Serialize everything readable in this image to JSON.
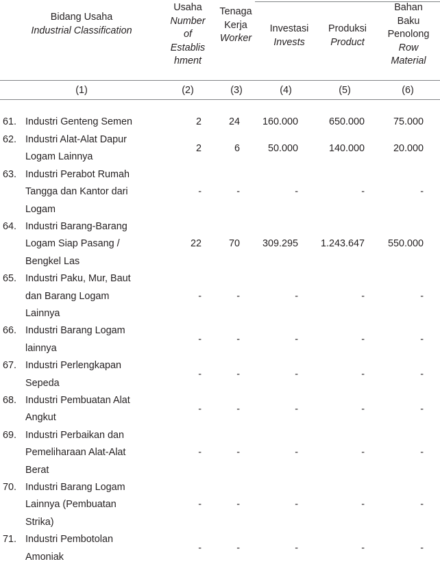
{
  "table": {
    "rules": {
      "color": "#808285"
    },
    "header": {
      "columns": [
        {
          "key": "classification",
          "id": "bidang-usaha",
          "id_label": "Bidang Usaha",
          "en_label": "Industrial Classification"
        },
        {
          "key": "establishment",
          "id": "usaha",
          "id_label": "Usaha",
          "en_label": "Number of Establis hment"
        },
        {
          "key": "worker",
          "id": "tenaga-kerja",
          "id_label": "Tenaga Kerja",
          "en_label": "Worker"
        },
        {
          "key": "invests",
          "id": "investasi",
          "id_label": "Investasi",
          "en_label": "Invests"
        },
        {
          "key": "product",
          "id": "produksi",
          "id_label": "Produksi",
          "en_label": "Product"
        },
        {
          "key": "raw_material",
          "id": "bahan-baku",
          "id_label": "Bahan Baku Penolong",
          "en_label": "Row Material"
        }
      ],
      "col_usaha_lines_id": [
        "Usaha"
      ],
      "col_usaha_lines_en": [
        "Number",
        "of",
        "Establis",
        "hment"
      ],
      "col_tenaga_lines_id": [
        "Tenaga",
        "Kerja"
      ],
      "col_tenaga_lines_en": [
        "Worker"
      ],
      "col_investasi_lines_id": [
        "Investasi"
      ],
      "col_investasi_lines_en": [
        "Invests"
      ],
      "col_produksi_lines_id": [
        "Produksi"
      ],
      "col_produksi_lines_en": [
        "Product"
      ],
      "col_bahan_lines_id": [
        "Bahan",
        "Baku",
        "Penolong"
      ],
      "col_bahan_lines_en": [
        "Row",
        "Material"
      ],
      "col_bidang_lines_id": [
        "Bidang Usaha"
      ],
      "col_bidang_lines_en": [
        "Industrial Classification"
      ]
    },
    "column_numbers": [
      "(1)",
      "(2)",
      "(3)",
      "(4)",
      "(5)",
      "(6)"
    ],
    "rows": [
      {
        "no": "61.",
        "name_lines": [
          "Industri Genteng Semen"
        ],
        "values": [
          "2",
          "24",
          "160.000",
          "650.000",
          "75.000"
        ]
      },
      {
        "no": "62.",
        "name_lines": [
          "Industri Alat-Alat Dapur",
          "Logam Lainnya"
        ],
        "values": [
          "2",
          "6",
          "50.000",
          "140.000",
          "20.000"
        ]
      },
      {
        "no": "63.",
        "name_lines": [
          "Industri Perabot Rumah",
          "Tangga dan Kantor dari",
          "Logam"
        ],
        "values": [
          "-",
          "-",
          "-",
          "-",
          "-"
        ]
      },
      {
        "no": "64.",
        "name_lines": [
          "Industri Barang-Barang",
          "Logam Siap Pasang /",
          "Bengkel Las"
        ],
        "values": [
          "22",
          "70",
          "309.295",
          "1.243.647",
          "550.000"
        ]
      },
      {
        "no": "65.",
        "name_lines": [
          "Industri Paku, Mur, Baut",
          "dan Barang Logam",
          "Lainnya"
        ],
        "values": [
          "-",
          "-",
          "-",
          "-",
          "-"
        ]
      },
      {
        "no": "66.",
        "name_lines": [
          "Industri Barang Logam",
          "lainnya"
        ],
        "values": [
          "-",
          "-",
          "-",
          "-",
          "-"
        ]
      },
      {
        "no": "67.",
        "name_lines": [
          "Industri Perlengkapan",
          "Sepeda"
        ],
        "values": [
          "-",
          "-",
          "-",
          "-",
          "-"
        ]
      },
      {
        "no": "68.",
        "name_lines": [
          "Industri Pembuatan Alat",
          "Angkut"
        ],
        "values": [
          "-",
          "-",
          "-",
          "-",
          "-"
        ]
      },
      {
        "no": "69.",
        "name_lines": [
          "Industri Perbaikan dan",
          "Pemeliharaan Alat-Alat",
          "Berat"
        ],
        "values": [
          "-",
          "-",
          "-",
          "-",
          "-"
        ]
      },
      {
        "no": "70.",
        "name_lines": [
          "Industri Barang Logam",
          "Lainnya (Pembuatan",
          "Strika)"
        ],
        "values": [
          "-",
          "-",
          "-",
          "-",
          "-"
        ]
      },
      {
        "no": "71.",
        "name_lines": [
          "Industri Pembotolan",
          "Amoniak"
        ],
        "values": [
          "-",
          "-",
          "-",
          "-",
          "-"
        ]
      }
    ]
  }
}
